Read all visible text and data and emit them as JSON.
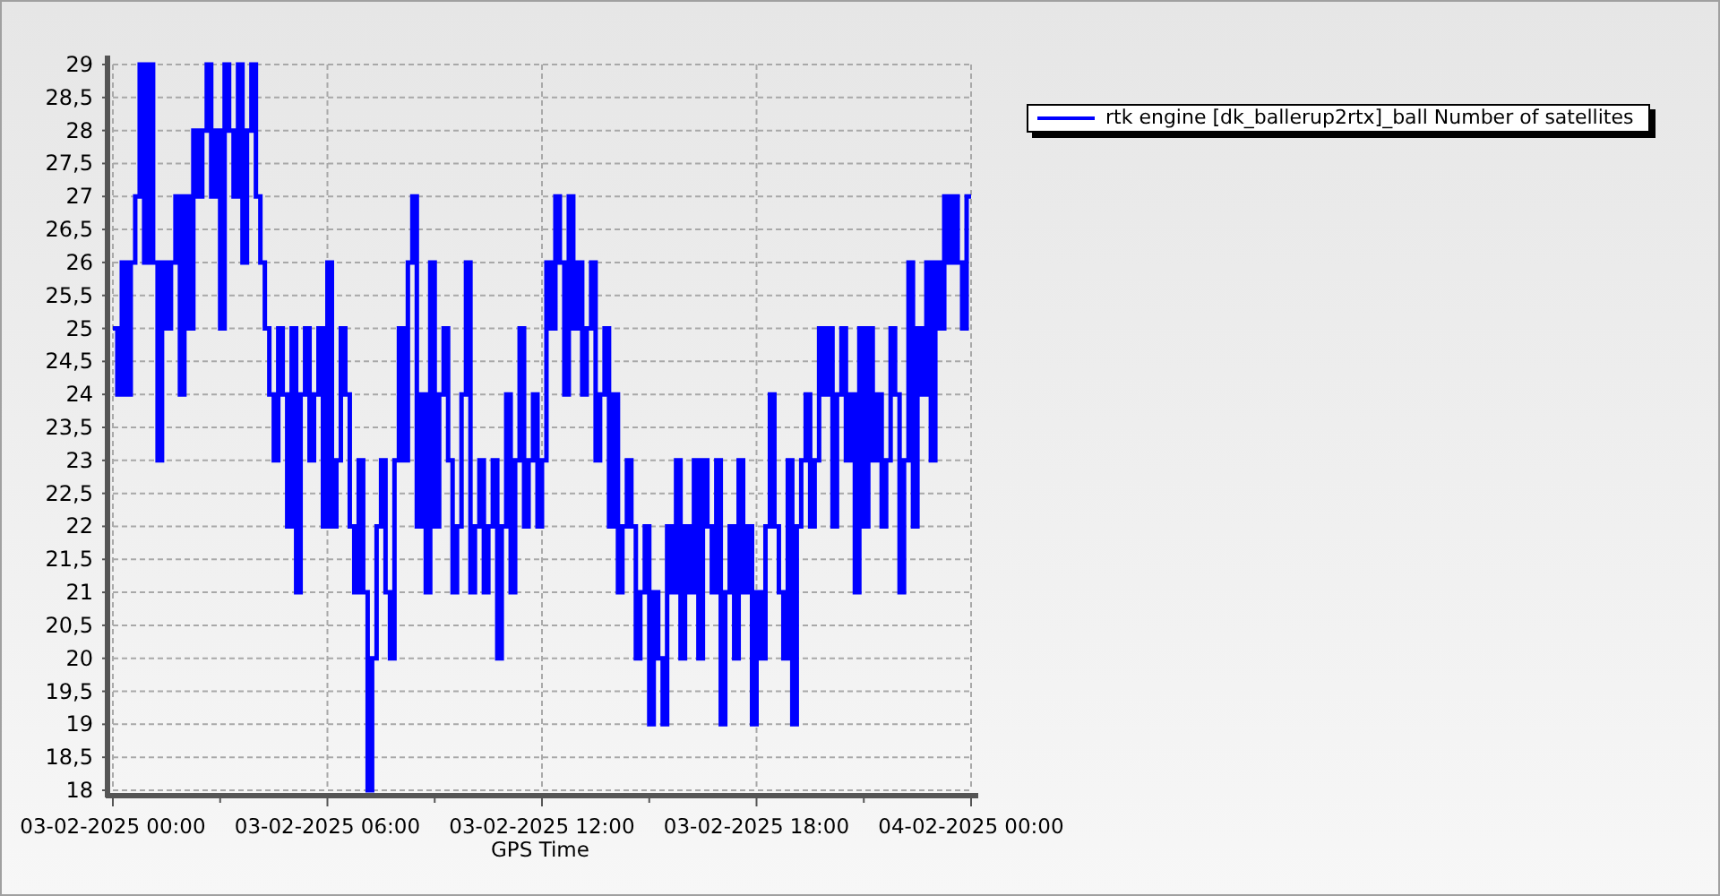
{
  "chart_data": {
    "type": "line",
    "grid": true,
    "xlabel": "GPS Time",
    "ylim": [
      18,
      29
    ],
    "categories": [
      "03-02-2025 00:00",
      null,
      null,
      null,
      null,
      null,
      null,
      null,
      null,
      null,
      null,
      null,
      null,
      null,
      null,
      null,
      null,
      null,
      null,
      null,
      null,
      null,
      null,
      null,
      null,
      null,
      null,
      null,
      null,
      null,
      null,
      null,
      null,
      null,
      null,
      null,
      null,
      null,
      null,
      null,
      null,
      null,
      null,
      null,
      null,
      null,
      null,
      null,
      "03-02-2025 06:00",
      null,
      null,
      null,
      null,
      null,
      null,
      null,
      null,
      null,
      null,
      null,
      null,
      null,
      null,
      null,
      null,
      null,
      null,
      null,
      null,
      null,
      null,
      null,
      null,
      null,
      null,
      null,
      null,
      null,
      null,
      null,
      null,
      null,
      null,
      null,
      null,
      null,
      null,
      null,
      null,
      null,
      null,
      null,
      null,
      null,
      null,
      null,
      "03-02-2025 12:00",
      null,
      null,
      null,
      null,
      null,
      null,
      null,
      null,
      null,
      null,
      null,
      null,
      null,
      null,
      null,
      null,
      null,
      null,
      null,
      null,
      null,
      null,
      null,
      null,
      null,
      null,
      null,
      null,
      null,
      null,
      null,
      null,
      null,
      null,
      null,
      null,
      null,
      null,
      null,
      null,
      null,
      null,
      null,
      null,
      null,
      null,
      null,
      "03-02-2025 18:00",
      null,
      null,
      null,
      null,
      null,
      null,
      null,
      null,
      null,
      null,
      null,
      null,
      null,
      null,
      null,
      null,
      null,
      null,
      null,
      null,
      null,
      null,
      null,
      null,
      null,
      null,
      null,
      null,
      null,
      null,
      null,
      null,
      null,
      null,
      null,
      null,
      null,
      null,
      null,
      null,
      null,
      null,
      null,
      null,
      null,
      null,
      null,
      "04-02-2025 00:00"
    ],
    "yticks": [
      {
        "value": 18,
        "label": "18"
      },
      {
        "value": 18.5,
        "label": "18,5"
      },
      {
        "value": 19,
        "label": "19"
      },
      {
        "value": 19.5,
        "label": "19,5"
      },
      {
        "value": 20,
        "label": "20"
      },
      {
        "value": 20.5,
        "label": "20,5"
      },
      {
        "value": 21,
        "label": "21"
      },
      {
        "value": 21.5,
        "label": "21,5"
      },
      {
        "value": 22,
        "label": "22"
      },
      {
        "value": 22.5,
        "label": "22,5"
      },
      {
        "value": 23,
        "label": "23"
      },
      {
        "value": 23.5,
        "label": "23,5"
      },
      {
        "value": 24,
        "label": "24"
      },
      {
        "value": 24.5,
        "label": "24,5"
      },
      {
        "value": 25,
        "label": "25"
      },
      {
        "value": 25.5,
        "label": "25,5"
      },
      {
        "value": 26,
        "label": "26"
      },
      {
        "value": 26.5,
        "label": "26,5"
      },
      {
        "value": 27,
        "label": "27"
      },
      {
        "value": 27.5,
        "label": "27,5"
      },
      {
        "value": 28,
        "label": "28"
      },
      {
        "value": 28.5,
        "label": "28,5"
      },
      {
        "value": 29,
        "label": "29"
      }
    ],
    "series": [
      {
        "name": "rtk engine [dk_ballerup2rtx]_ball Number of satellites",
        "color": "#0000ff",
        "values": [
          25,
          24,
          26,
          24,
          26,
          27,
          29,
          26,
          29,
          26,
          23,
          26,
          25,
          26,
          27,
          24,
          27,
          25,
          28,
          27,
          28,
          29,
          27,
          28,
          25,
          29,
          28,
          27,
          29,
          26,
          28,
          29,
          27,
          26,
          25,
          24,
          23,
          25,
          24,
          22,
          25,
          21,
          24,
          25,
          23,
          24,
          25,
          22,
          26,
          22,
          23,
          25,
          24,
          22,
          21,
          23,
          21,
          18,
          20,
          22,
          23,
          21,
          20,
          23,
          25,
          23,
          26,
          27,
          22,
          24,
          21,
          26,
          22,
          24,
          25,
          23,
          21,
          22,
          24,
          26,
          21,
          22,
          23,
          21,
          22,
          23,
          20,
          22,
          24,
          21,
          23,
          25,
          22,
          23,
          24,
          22,
          23,
          26,
          25,
          27,
          26,
          24,
          27,
          25,
          26,
          24,
          25,
          26,
          23,
          24,
          25,
          22,
          24,
          21,
          22,
          23,
          22,
          20,
          21,
          22,
          19,
          21,
          20,
          19,
          22,
          21,
          23,
          20,
          22,
          21,
          23,
          20,
          23,
          22,
          21,
          23,
          19,
          21,
          22,
          20,
          23,
          21,
          22,
          19,
          21,
          20,
          22,
          24,
          22,
          21,
          20,
          23,
          19,
          22,
          23,
          24,
          22,
          23,
          25,
          24,
          25,
          22,
          24,
          25,
          23,
          24,
          21,
          25,
          22,
          25,
          23,
          24,
          22,
          23,
          25,
          24,
          21,
          23,
          26,
          22,
          25,
          24,
          26,
          23,
          26,
          25,
          27,
          26,
          27,
          26,
          25,
          27,
          27
        ]
      }
    ]
  }
}
